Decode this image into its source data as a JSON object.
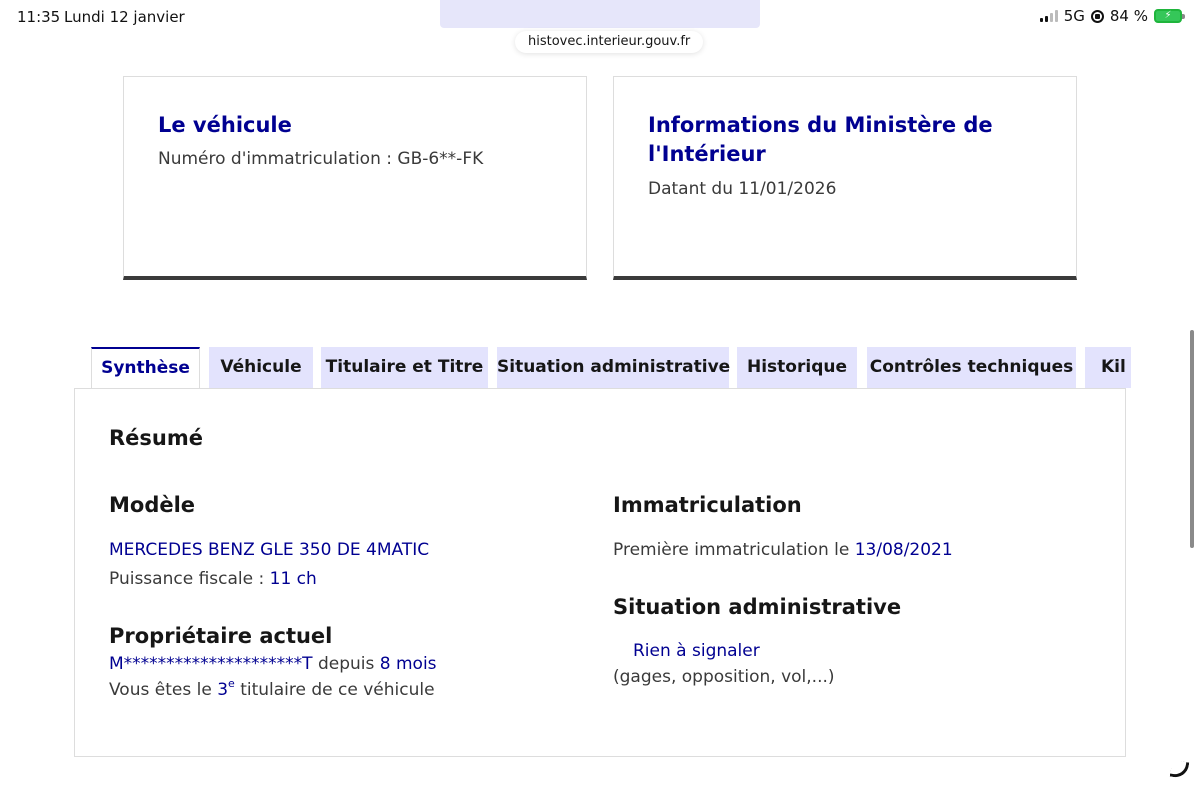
{
  "status_bar": {
    "time": "11:35",
    "date": "Lundi 12 janvier",
    "network": "5G",
    "battery": "84 %"
  },
  "browser": {
    "url": "histovec.interieur.gouv.fr"
  },
  "cards": {
    "vehicle": {
      "title": "Le véhicule",
      "desc": "Numéro d'immatriculation : GB-6**-FK"
    },
    "ministry": {
      "title": "Informations du Ministère de l'Intérieur",
      "desc": "Datant du 11/01/2026"
    }
  },
  "tabs": [
    {
      "label": "Synthèse",
      "active": true
    },
    {
      "label": "Véhicule"
    },
    {
      "label": "Titulaire et Titre"
    },
    {
      "label": "Situation administrative"
    },
    {
      "label": "Historique"
    },
    {
      "label": "Contrôles techniques"
    },
    {
      "label": "Kil"
    }
  ],
  "summary": {
    "title": "Résumé",
    "model": {
      "heading": "Modèle",
      "name": "MERCEDES BENZ GLE 350 DE 4MATIC",
      "power_label": "Puissance fiscale : ",
      "power_value": "11 ch"
    },
    "owner": {
      "heading": "Propriétaire actuel",
      "name": "M*********************T",
      "since_label": " depuis ",
      "since_value": "8 mois",
      "rank_prefix": "Vous êtes le ",
      "rank_number": "3",
      "rank_suffix": "e",
      "rank_rest": " titulaire de ce véhicule"
    },
    "registration": {
      "heading": "Immatriculation",
      "first_label": "Première immatriculation le ",
      "first_date": "13/08/2021"
    },
    "admin": {
      "heading": "Situation administrative",
      "status": "Rien à signaler",
      "details": "(gages, opposition, vol,...)"
    }
  },
  "colors": {
    "accent": "#000091",
    "tab_bg": "#e3e3fd",
    "text": "#3a3a3a",
    "battery": "#35c759"
  }
}
